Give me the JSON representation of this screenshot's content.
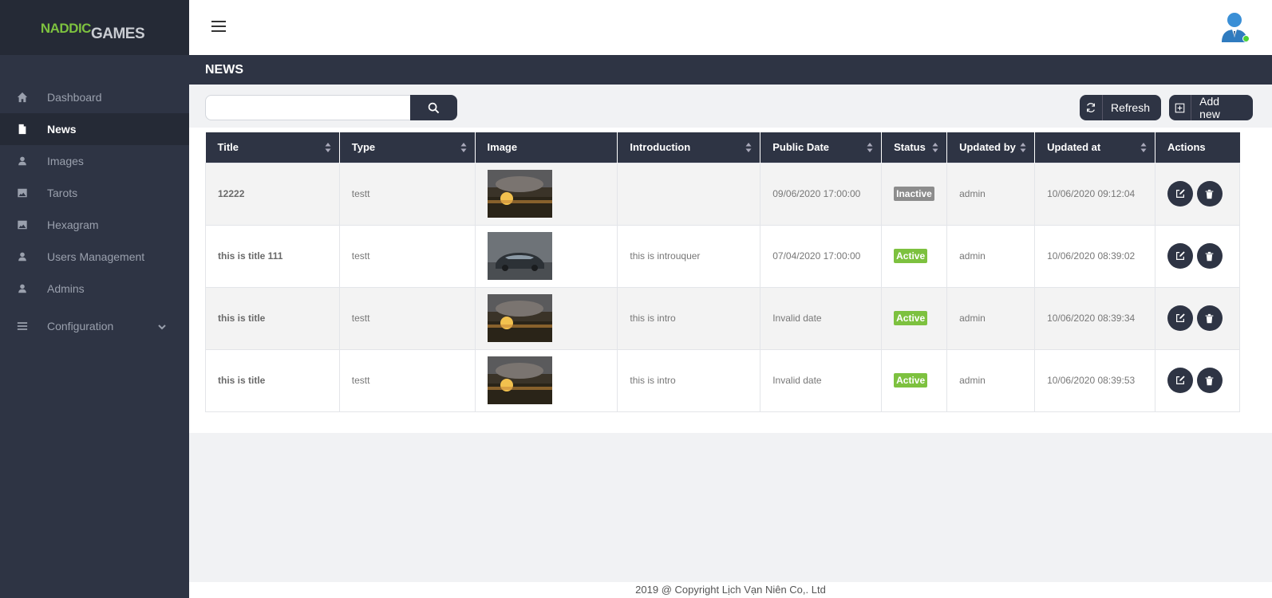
{
  "logo": {
    "part1": "NADDIC",
    "part2": "GAMES"
  },
  "sidebar": {
    "items": [
      {
        "label": "Dashboard",
        "icon": "home-icon"
      },
      {
        "label": "News",
        "icon": "file-icon",
        "active": true
      },
      {
        "label": "Images",
        "icon": "user-icon"
      },
      {
        "label": "Tarots",
        "icon": "image-icon"
      },
      {
        "label": "Hexagram",
        "icon": "image-icon"
      },
      {
        "label": "Users Management",
        "icon": "user-icon"
      },
      {
        "label": "Admins",
        "icon": "user-icon"
      },
      {
        "label": "Configuration",
        "icon": "menu-icon"
      }
    ]
  },
  "page": {
    "title": "NEWS"
  },
  "search": {
    "value": "",
    "placeholder": ""
  },
  "toolbar": {
    "refresh_label": "Refresh",
    "add_label": "Add new"
  },
  "table": {
    "headers": [
      "Title",
      "Type",
      "Image",
      "Introduction",
      "Public Date",
      "Status",
      "Updated by",
      "Updated at",
      "Actions"
    ],
    "rows": [
      {
        "title": "12222",
        "type": "testt",
        "image": "landscape-thumbnail",
        "intro": "",
        "public_date": "09/06/2020 17:00:00",
        "status": "Inactive",
        "updated_by": "admin",
        "updated_at": "10/06/2020 09:12:04"
      },
      {
        "title": "this is title 111",
        "type": "testt",
        "image": "car-thumbnail",
        "intro": "this is introuquer",
        "public_date": "07/04/2020 17:00:00",
        "status": "Active",
        "updated_by": "admin",
        "updated_at": "10/06/2020 08:39:02"
      },
      {
        "title": "this is title",
        "type": "testt",
        "image": "landscape-thumbnail",
        "intro": "this is intro",
        "public_date": "Invalid date",
        "status": "Active",
        "updated_by": "admin",
        "updated_at": "10/06/2020 08:39:34"
      },
      {
        "title": "this is title",
        "type": "testt",
        "image": "landscape-thumbnail",
        "intro": "this is intro",
        "public_date": "Invalid date",
        "status": "Active",
        "updated_by": "admin",
        "updated_at": "10/06/2020 08:39:53"
      }
    ]
  },
  "footer": {
    "text": "2019 @ Copyright Lịch Vạn Niên Co,. Ltd"
  },
  "colors": {
    "dark": "#2e3444",
    "accent_green": "#7dc13f",
    "inactive_gray": "#8c8c8c"
  }
}
